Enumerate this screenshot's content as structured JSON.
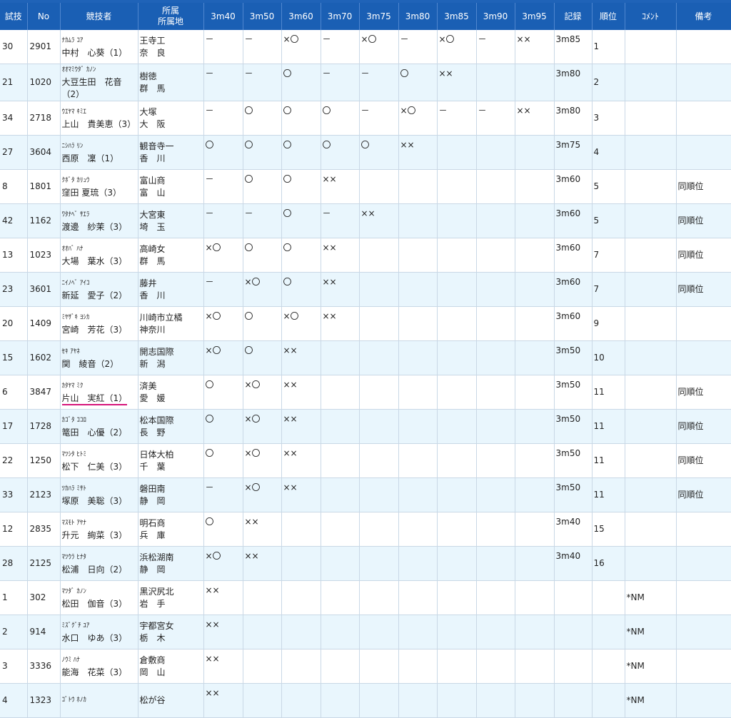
{
  "header": {
    "trial": "試技",
    "no": "No",
    "athlete": "競技者",
    "affiliation_1": "所属",
    "affiliation_2": "所属地",
    "heights": [
      "3m40",
      "3m50",
      "3m60",
      "3m70",
      "3m75",
      "3m80",
      "3m85",
      "3m90",
      "3m95"
    ],
    "record": "記録",
    "rank": "順位",
    "comment": "ｺﾒﾝﾄ",
    "notes": "備考"
  },
  "rows": [
    {
      "trial": "30",
      "no": "2901",
      "kana": "ﾅｶﾑﾗ ｺｱ",
      "name": "中村　心葵（1）",
      "school": "王寺工",
      "pref": "奈　良",
      "marks": [
        "－",
        "－",
        "×〇",
        "－",
        "×〇",
        "－",
        "×〇",
        "－",
        "××"
      ],
      "record": "3m85",
      "rank": "1",
      "comment": "",
      "note": ""
    },
    {
      "trial": "21",
      "no": "1020",
      "kana": "ｵｵﾏﾐｳﾀﾞ ｶﾉﾝ",
      "name": "大豆生田　花音",
      "name2": "（2）",
      "school": "樹徳",
      "pref": "群　馬",
      "marks": [
        "－",
        "－",
        "〇",
        "－",
        "－",
        "〇",
        "××",
        "",
        ""
      ],
      "record": "3m80",
      "rank": "2",
      "comment": "",
      "note": ""
    },
    {
      "trial": "34",
      "no": "2718",
      "kana": "ｳｴﾔﾏ ｷﾐｴ",
      "name": "上山　貴美恵（3）",
      "school": "大塚",
      "pref": "大　阪",
      "marks": [
        "－",
        "〇",
        "〇",
        "〇",
        "－",
        "×〇",
        "－",
        "－",
        "××"
      ],
      "record": "3m80",
      "rank": "3",
      "comment": "",
      "note": ""
    },
    {
      "trial": "27",
      "no": "3604",
      "kana": "ﾆｼﾊﾗ ﾘﾝ",
      "name": "西原　凜（1）",
      "school": "観音寺一",
      "pref": "香　川",
      "marks": [
        "〇",
        "〇",
        "〇",
        "〇",
        "〇",
        "××",
        "",
        "",
        ""
      ],
      "record": "3m75",
      "rank": "4",
      "comment": "",
      "note": ""
    },
    {
      "trial": "8",
      "no": "1801",
      "kana": "ｸﾎﾞﾀ ｶﾘｭｳ",
      "name": "窪田 夏琉（3）",
      "school": "富山商",
      "pref": "富　山",
      "marks": [
        "－",
        "〇",
        "〇",
        "××",
        "",
        "",
        "",
        "",
        ""
      ],
      "record": "3m60",
      "rank": "5",
      "comment": "",
      "note": "同順位"
    },
    {
      "trial": "42",
      "no": "1162",
      "kana": "ﾜﾀﾅﾍﾞ ｻｴﾗ",
      "name": "渡邊　紗茉（3）",
      "school": "大宮東",
      "pref": "埼　玉",
      "marks": [
        "－",
        "－",
        "〇",
        "－",
        "××",
        "",
        "",
        "",
        ""
      ],
      "record": "3m60",
      "rank": "5",
      "comment": "",
      "note": "同順位"
    },
    {
      "trial": "13",
      "no": "1023",
      "kana": "ｵｵﾊﾞ ﾊﾅ",
      "name": "大場　葉水（3）",
      "school": "高崎女",
      "pref": "群　馬",
      "marks": [
        "×〇",
        "〇",
        "〇",
        "××",
        "",
        "",
        "",
        "",
        ""
      ],
      "record": "3m60",
      "rank": "7",
      "comment": "",
      "note": "同順位"
    },
    {
      "trial": "23",
      "no": "3601",
      "kana": "ﾆｲﾉﾍﾞ ｱｲｺ",
      "name": "新延　愛子（2）",
      "school": "藤井",
      "pref": "香　川",
      "marks": [
        "－",
        "×〇",
        "〇",
        "××",
        "",
        "",
        "",
        "",
        ""
      ],
      "record": "3m60",
      "rank": "7",
      "comment": "",
      "note": "同順位"
    },
    {
      "trial": "20",
      "no": "1409",
      "kana": "ﾐﾔｻﾞｷ ﾖｼｶ",
      "name": "宮崎　芳花（3）",
      "school": "川崎市立橘",
      "pref": "神奈川",
      "marks": [
        "×〇",
        "〇",
        "×〇",
        "××",
        "",
        "",
        "",
        "",
        ""
      ],
      "record": "3m60",
      "rank": "9",
      "comment": "",
      "note": ""
    },
    {
      "trial": "15",
      "no": "1602",
      "kana": "ｾｷ ｱﾔﾈ",
      "name": "関　綾音（2）",
      "school": "開志国際",
      "pref": "新　潟",
      "marks": [
        "×〇",
        "〇",
        "××",
        "",
        "",
        "",
        "",
        "",
        ""
      ],
      "record": "3m50",
      "rank": "10",
      "comment": "",
      "note": ""
    },
    {
      "trial": "6",
      "no": "3847",
      "kana": "ｶﾀﾔﾏ ﾐｸ",
      "name": "片山　実紅（1）",
      "school": "済美",
      "pref": "愛　媛",
      "marks": [
        "〇",
        "×〇",
        "××",
        "",
        "",
        "",
        "",
        "",
        ""
      ],
      "record": "3m50",
      "rank": "11",
      "comment": "",
      "note": "同順位",
      "underline": true
    },
    {
      "trial": "17",
      "no": "1728",
      "kana": "ｶｺﾞﾀ ｺｺﾛ",
      "name": "篭田　心優（2）",
      "school": "松本国際",
      "pref": "長　野",
      "marks": [
        "〇",
        "×〇",
        "××",
        "",
        "",
        "",
        "",
        "",
        ""
      ],
      "record": "3m50",
      "rank": "11",
      "comment": "",
      "note": "同順位"
    },
    {
      "trial": "22",
      "no": "1250",
      "kana": "ﾏﾂｼﾀ ﾋﾄﾐ",
      "name": "松下　仁美（3）",
      "school": "日体大柏",
      "pref": "千　葉",
      "marks": [
        "〇",
        "×〇",
        "××",
        "",
        "",
        "",
        "",
        "",
        ""
      ],
      "record": "3m50",
      "rank": "11",
      "comment": "",
      "note": "同順位"
    },
    {
      "trial": "33",
      "no": "2123",
      "kana": "ﾂｶﾊﾗ ﾐｻﾄ",
      "name": "塚原　美聡（3）",
      "school": "磐田南",
      "pref": "静　岡",
      "marks": [
        "－",
        "×〇",
        "××",
        "",
        "",
        "",
        "",
        "",
        ""
      ],
      "record": "3m50",
      "rank": "11",
      "comment": "",
      "note": "同順位"
    },
    {
      "trial": "12",
      "no": "2835",
      "kana": "ﾏｽﾓﾄ ｱﾔﾅ",
      "name": "升元　絢菜（3）",
      "school": "明石商",
      "pref": "兵　庫",
      "marks": [
        "〇",
        "××",
        "",
        "",
        "",
        "",
        "",
        "",
        ""
      ],
      "record": "3m40",
      "rank": "15",
      "comment": "",
      "note": ""
    },
    {
      "trial": "28",
      "no": "2125",
      "kana": "ﾏﾂｳﾗ ﾋﾅﾀ",
      "name": "松浦　日向（2）",
      "school": "浜松湖南",
      "pref": "静　岡",
      "marks": [
        "×〇",
        "××",
        "",
        "",
        "",
        "",
        "",
        "",
        ""
      ],
      "record": "3m40",
      "rank": "16",
      "comment": "",
      "note": ""
    },
    {
      "trial": "1",
      "no": "302",
      "kana": "ﾏﾂﾀﾞ ｶﾉﾝ",
      "name": "松田　伽音（3）",
      "school": "黒沢尻北",
      "pref": "岩　手",
      "marks": [
        "××",
        "",
        "",
        "",
        "",
        "",
        "",
        "",
        ""
      ],
      "record": "",
      "rank": "",
      "comment": "*NM",
      "note": ""
    },
    {
      "trial": "2",
      "no": "914",
      "kana": "ﾐｽﾞｸﾞﾁ ﾕｱ",
      "name": "水口　ゆあ（3）",
      "school": "宇都宮女",
      "pref": "栃　木",
      "marks": [
        "××",
        "",
        "",
        "",
        "",
        "",
        "",
        "",
        ""
      ],
      "record": "",
      "rank": "",
      "comment": "*NM",
      "note": ""
    },
    {
      "trial": "3",
      "no": "3336",
      "kana": "ﾉｳﾐ ﾊﾅ",
      "name": "能海　花菜（3）",
      "school": "倉敷商",
      "pref": "岡　山",
      "marks": [
        "××",
        "",
        "",
        "",
        "",
        "",
        "",
        "",
        ""
      ],
      "record": "",
      "rank": "",
      "comment": "*NM",
      "note": ""
    },
    {
      "trial": "4",
      "no": "1323",
      "kana": "ｺﾞﾄｳ ﾎﾉｶ",
      "name": "",
      "school": "松が谷",
      "pref": "",
      "marks": [
        "××",
        "",
        "",
        "",
        "",
        "",
        "",
        "",
        ""
      ],
      "record": "",
      "rank": "",
      "comment": "*NM",
      "note": ""
    }
  ]
}
